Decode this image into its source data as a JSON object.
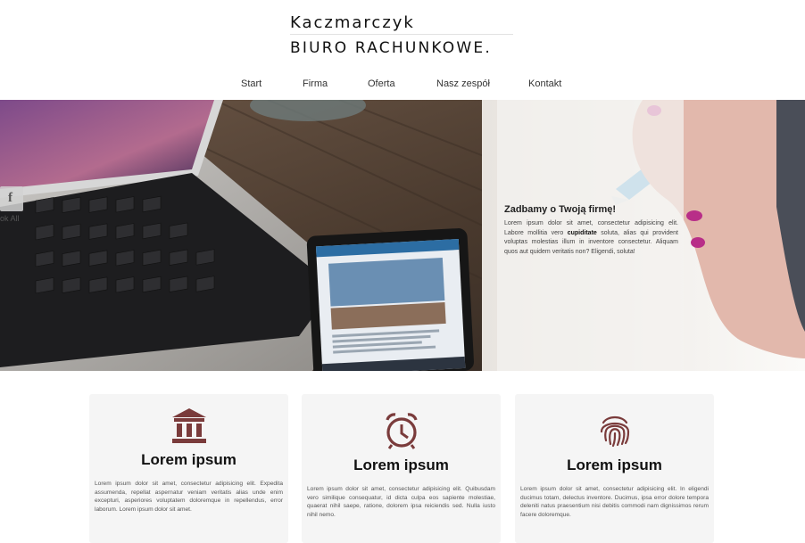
{
  "brand": {
    "line1": "Kaczmarczyk",
    "line2": "BIURO RACHUNKOWE."
  },
  "nav": {
    "items": [
      {
        "label": "Start"
      },
      {
        "label": "Firma"
      },
      {
        "label": "Oferta"
      },
      {
        "label": "Nasz zespół"
      },
      {
        "label": "Kontakt"
      }
    ]
  },
  "hero": {
    "title": "Zadbamy o Twoją firmę!",
    "text_before": "Lorem ipsum dolor sit amet, consectetur adipisicing elit. Labore mollitia vero ",
    "text_bold": "cupiditate",
    "text_after": " soluta, alias qui provident voluptas molestias illum in inventore consectetur. Aliquam quos aut quidem veritatis non? Eligendi, soluta!",
    "social_letter": "f",
    "laptop_fragment": "ok All"
  },
  "cards": [
    {
      "icon": "bank-icon",
      "title": "Lorem ipsum",
      "text": "Lorem ipsum dolor sit amet, consectetur adipisicing elit. Expedita assumenda, repellat aspernatur veniam veritatis alias unde enim excepturi, asperiores voluptatem doloremque in repellendus, error laborum. Lorem ipsum dolor sit amet."
    },
    {
      "icon": "alarm-clock-icon",
      "title": "Lorem ipsum",
      "text": "Lorem ipsum dolor sit amet, consectetur adipisicing elit. Quibusdam vero similique consequatur, id dicta culpa eos sapiente molestiae, quaerat nihil saepe, ratione, dolorem ipsa reiciendis sed. Nulla iusto nihil nemo."
    },
    {
      "icon": "fingerprint-icon",
      "title": "Lorem ipsum",
      "text": "Lorem ipsum dolor sit amet, consectetur adipisicing elit. In eligendi ducimus totam, delectus inventore. Ducimus, ipsa error dolore tempora deleniti natus praesentium nisi debitis commodi nam dignissimos rerum facere doloremque."
    }
  ],
  "colors": {
    "accent": "#7a3b3b",
    "card_bg": "#f5f5f5"
  }
}
